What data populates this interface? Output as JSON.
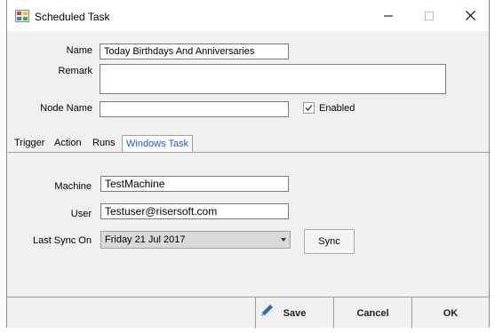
{
  "window": {
    "title": "Scheduled Task"
  },
  "icons": {
    "app": "scheduled-task-app-icon",
    "minimize": "minimize-icon",
    "maximize": "maximize-icon",
    "close": "close-icon",
    "save": "pencil-icon",
    "dropdown": "chevron-down-icon"
  },
  "form": {
    "name_label": "Name",
    "name_value": "Today Birthdays And Anniversaries",
    "remark_label": "Remark",
    "remark_value": "",
    "node_label": "Node Name",
    "node_value": "",
    "enabled_label": "Enabled",
    "enabled_checked": true
  },
  "tabs": [
    {
      "label": "Trigger",
      "active": false
    },
    {
      "label": "Action",
      "active": false
    },
    {
      "label": "Runs",
      "active": false
    },
    {
      "label": "Windows Task",
      "active": true
    }
  ],
  "windows_task": {
    "machine_label": "Machine",
    "machine_value": "TestMachine",
    "user_label": "User",
    "user_value": "Testuser@risersoft.com",
    "last_sync_label": "Last Sync On",
    "last_sync_value": "Friday 21 Jul 2017",
    "sync_button": "Sync"
  },
  "footer": {
    "save_label": "Save",
    "cancel_label": "Cancel",
    "ok_label": "OK"
  },
  "colors": {
    "active_tab_text": "#1a5fb4",
    "pencil": "#2b6cb0"
  }
}
